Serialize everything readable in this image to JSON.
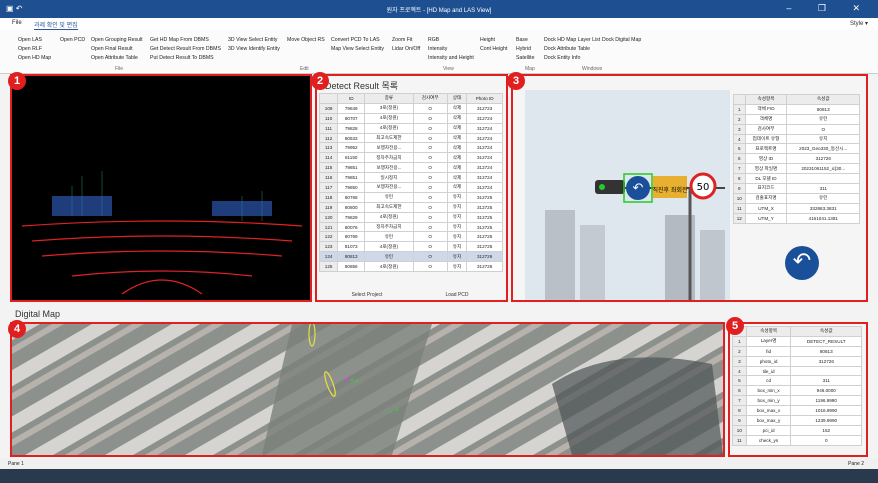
{
  "app": {
    "title": "원자 프로젝트 - [HD Map and LAS View]",
    "window_controls": "–  ❐  ✕"
  },
  "tabs": {
    "file": "File",
    "project": "과제 확인 및 편집",
    "style": "Style ▾"
  },
  "ribbon": {
    "open_las": "Open LAS",
    "open_rlf": "Open RLF",
    "open_hd_map": "Open HD Map",
    "open_pcd": "Open PCD",
    "open_grouping": "Open Grouping Result",
    "open_final": "Open Final Result",
    "open_attr": "Open Attribute Table",
    "get_hd": "Get HD Map From DBMS",
    "get_detect": "Get Detect Result From DBMS",
    "put_detect": "Put Detect Result To DBMS",
    "view_select": "3D View Select Entity",
    "view_identify": "3D View Identify Entity",
    "move_obj": "Move Object RS",
    "convert_pcd": "Convert PCD To LAS",
    "map_select": "Map View Select Entity",
    "zoom_fit": "Zoom Fit",
    "lidar": "Lidar On/Off",
    "rgb": "RGB",
    "intensity": "Intensity",
    "int_height": "Intensity and Height",
    "height": "Height",
    "cont_height": "Cont Height",
    "base": "Base",
    "hybrid": "Hybrid",
    "satellite": "Satellite",
    "dock_hd": "Dock HD Map Layer List",
    "dock_digital": "Dock Digital Map",
    "dock_attr": "Dock Attribute Table",
    "dock_entity": "Dock Entity Info",
    "grp_file": "File",
    "grp_edit": "Edit",
    "grp_view": "View",
    "grp_map": "Map",
    "grp_windows": "Windows"
  },
  "badges": [
    "1",
    "2",
    "3",
    "4",
    "5"
  ],
  "detect": {
    "title": "Detect Result 목록",
    "columns": [
      "",
      "ID",
      "종류",
      "검사여부",
      "상태",
      "Photo ID"
    ],
    "rows": [
      [
        "109",
        "79849",
        "3로(정원)",
        "O",
        "삭제",
        "312723"
      ],
      [
        "110",
        "80707",
        "4로(정원)",
        "O",
        "삭제",
        "312724"
      ],
      [
        "111",
        "79828",
        "4로(정원)",
        "O",
        "삭제",
        "312724"
      ],
      [
        "112",
        "80533",
        "최고속도제한",
        "O",
        "삭제",
        "312724"
      ],
      [
        "113",
        "79952",
        "보행자전용...",
        "O",
        "삭제",
        "312724"
      ],
      [
        "114",
        "81150",
        "정차주차금지",
        "O",
        "삭제",
        "312724"
      ],
      [
        "115",
        "79851",
        "보행자전용...",
        "O",
        "삭제",
        "312724"
      ],
      [
        "116",
        "79851",
        "일시정지",
        "O",
        "삭제",
        "312724"
      ],
      [
        "117",
        "79850",
        "보행자전용...",
        "O",
        "삭제",
        "312724"
      ],
      [
        "118",
        "80768",
        "유턴",
        "O",
        "유지",
        "312725"
      ],
      [
        "119",
        "80800",
        "최고속도제한",
        "O",
        "유지",
        "312725"
      ],
      [
        "120",
        "79829",
        "4로(정원)",
        "O",
        "유지",
        "312725"
      ],
      [
        "121",
        "80076",
        "정차주차금지",
        "O",
        "유지",
        "312725"
      ],
      [
        "122",
        "80769",
        "유턴",
        "O",
        "유지",
        "312725"
      ],
      [
        "123",
        "81073",
        "4로(정원)",
        "O",
        "유지",
        "312725"
      ],
      [
        "124",
        "80813",
        "유턴",
        "O",
        "유지",
        "312726"
      ],
      [
        "125",
        "80856",
        "4로(정원)",
        "O",
        "유지",
        "312726"
      ]
    ],
    "btn_select": "Select Project",
    "btn_load": "Load PCD"
  },
  "entity": {
    "columns": [
      "",
      "속성항목",
      "속성값"
    ],
    "rows": [
      [
        "1",
        "객체 FID",
        "80813"
      ],
      [
        "2",
        "객체명",
        "유턴"
      ],
      [
        "3",
        "검사여부",
        "O"
      ],
      [
        "4",
        "업데이트 유형",
        "유지"
      ],
      [
        "5",
        "프로젝트명",
        "2023_Geo330_동선시..."
      ],
      [
        "6",
        "영상 ID",
        "312726"
      ],
      [
        "7",
        "영상 파일명",
        "20231061152_ic[30..."
      ],
      [
        "8",
        "DL 모델 ID",
        ""
      ],
      [
        "9",
        "표지코드",
        "311"
      ],
      [
        "10",
        "검출표지명",
        "유턴"
      ],
      [
        "11",
        "UTM_X",
        "332863.3831"
      ],
      [
        "12",
        "UTM_Y",
        "4161041.1381"
      ]
    ],
    "sign_text": "직진후 좌회전",
    "speed": "50"
  },
  "digital_map": {
    "title": "Digital Map"
  },
  "attr": {
    "columns": [
      "",
      "속성항목",
      "속성값"
    ],
    "rows": [
      [
        "1",
        "Layer명",
        "DETECT_RESULT"
      ],
      [
        "2",
        "fid",
        "80813"
      ],
      [
        "3",
        "photo_id",
        "312726"
      ],
      [
        "4",
        "tile_id",
        ""
      ],
      [
        "5",
        "cd",
        "311"
      ],
      [
        "6",
        "box_min_x",
        "946.0000"
      ],
      [
        "7",
        "box_min_y",
        "1196.9990"
      ],
      [
        "8",
        "box_max_x",
        "1016.9990"
      ],
      [
        "9",
        "box_max_y",
        "1239.9990"
      ],
      [
        "10",
        "pci_id",
        "152"
      ],
      [
        "11",
        "check_yn",
        "0"
      ]
    ]
  },
  "status": {
    "left": "Pane 1",
    "right": "Pane 2"
  },
  "colors": {
    "title": "#1d4f91",
    "accent": "#2b579a",
    "highlight": "#e02020"
  }
}
